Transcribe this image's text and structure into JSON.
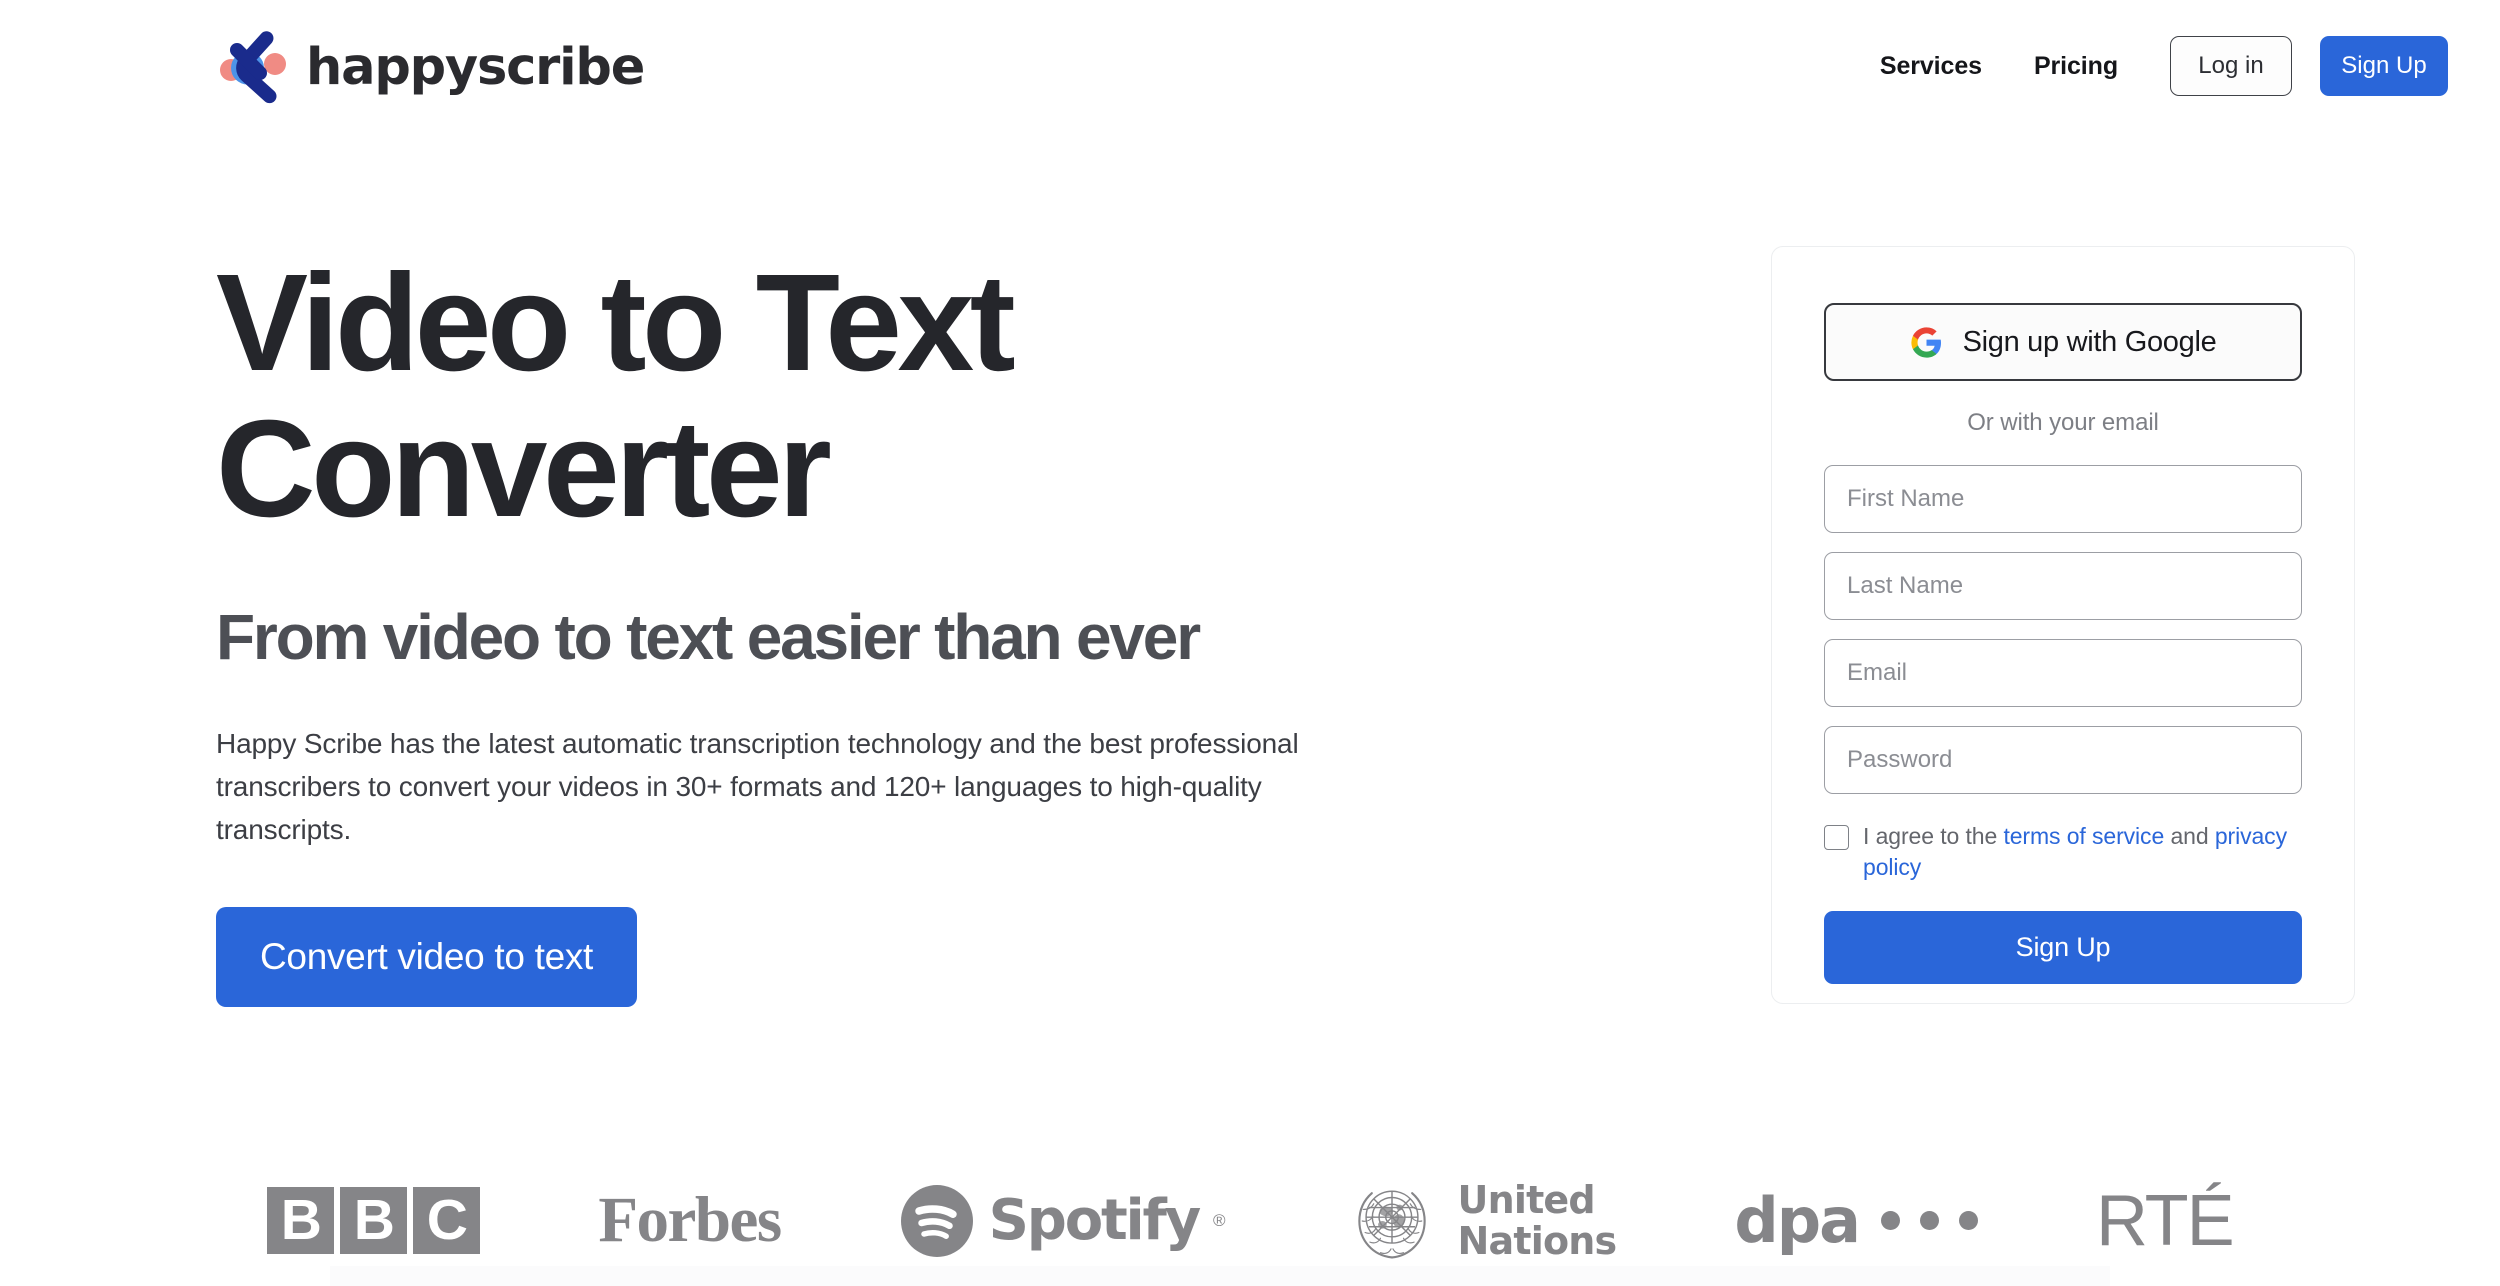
{
  "brand": {
    "name": "happyscribe",
    "mark_colors": {
      "navy": "#1a2b8c",
      "blue": "#4d93e8",
      "salmon": "#f08b84"
    }
  },
  "nav": {
    "links": [
      {
        "label": "Services"
      },
      {
        "label": "Pricing"
      }
    ],
    "login_label": "Log in",
    "signup_label": "Sign Up"
  },
  "hero": {
    "title": "Video to Text Converter",
    "subtitle": "From video to text easier than ever",
    "body": "Happy Scribe has the latest automatic transcription technology and the best professional transcribers to convert your videos in 30+ formats and 120+ languages to high-quality transcripts.",
    "cta_label": "Convert video to text"
  },
  "signup": {
    "google_label": "Sign up with Google",
    "divider_label": "Or with your email",
    "fields": [
      {
        "name": "first-name",
        "placeholder": "First Name",
        "type": "text",
        "value": ""
      },
      {
        "name": "last-name",
        "placeholder": "Last Name",
        "type": "text",
        "value": ""
      },
      {
        "name": "email",
        "placeholder": "Email",
        "type": "email",
        "value": ""
      },
      {
        "name": "password",
        "placeholder": "Password",
        "type": "password",
        "value": ""
      }
    ],
    "terms": {
      "prefix": "I agree to the ",
      "terms_link": "terms of service",
      "middle": " and ",
      "privacy_link": "privacy policy",
      "checked": false
    },
    "submit_label": "Sign Up"
  },
  "press": {
    "logos": [
      {
        "id": "bbc",
        "label": "BBC",
        "letters": [
          "B",
          "B",
          "C"
        ]
      },
      {
        "id": "forbes",
        "label": "Forbes"
      },
      {
        "id": "spotify",
        "label": "Spotify",
        "registered": "®"
      },
      {
        "id": "un",
        "label": "United Nations",
        "line1": "United",
        "line2": "Nations"
      },
      {
        "id": "dpa",
        "label": "dpa",
        "dots": 3
      },
      {
        "id": "rte",
        "label": "RTÉ"
      }
    ]
  },
  "colors": {
    "accent_blue": "#2a66d9",
    "link_blue": "#2a66d9",
    "heading": "#25262b",
    "subheading": "#4d4f55",
    "body_text": "#3c3e44",
    "muted": "#858588",
    "card_border": "#eceef0",
    "field_border": "#9c9ea4",
    "page_bg": "#ffffff"
  }
}
